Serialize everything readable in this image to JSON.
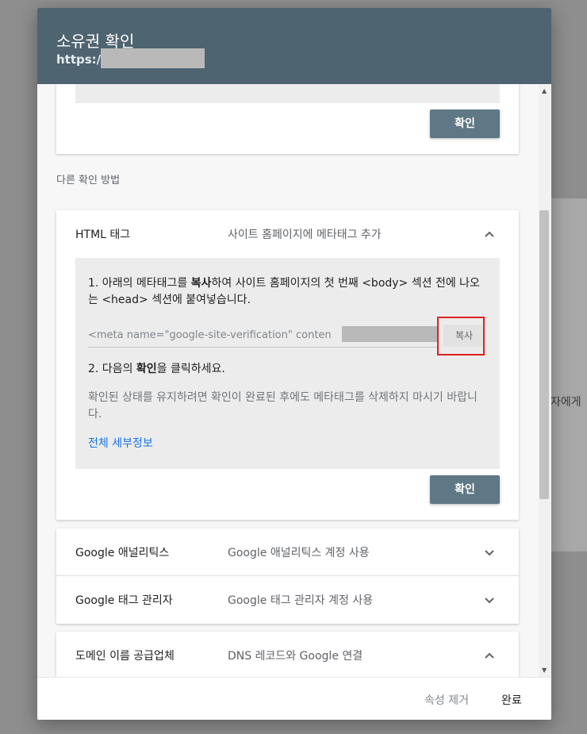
{
  "background": {
    "partial_text": "자에게"
  },
  "dialog": {
    "title": "소유권 확인",
    "url_prefix": "https://"
  },
  "top_card": {
    "confirm_label": "확인"
  },
  "other_methods_label": "다른 확인 방법",
  "html_tag": {
    "title": "HTML 태그",
    "description": "사이트 홈페이지에 메타태그 추가",
    "expanded": true,
    "step1_prefix": "1. 아래의 메타태그를 ",
    "step1_bold": "복사",
    "step1_suffix": "하여 사이트 홈페이지의 첫 번째 <body> 섹션 전에 나오는 <head> 섹션에 붙여넣습니다.",
    "meta_value": "<meta name=\"google-site-verification\" conten",
    "copy_label": "복사",
    "step2_prefix": "2. 다음의 ",
    "step2_bold": "확인",
    "step2_suffix": "을 클릭하세요.",
    "note": "확인된 상태를 유지하려면 확인이 완료된 후에도 메타태그를 삭제하지 마시기 바랍니다.",
    "details_link": "전체 세부정보",
    "confirm_label": "확인"
  },
  "methods": [
    {
      "title": "Google 애널리틱스",
      "description": "Google 애널리틱스 계정 사용",
      "expanded": false
    },
    {
      "title": "Google 태그 관리자",
      "description": "Google 태그 관리자 계정 사용",
      "expanded": false
    },
    {
      "title": "도메인 이름 공급업체",
      "description": "DNS 레코드와 Google 연결",
      "expanded": true
    }
  ],
  "footer": {
    "remove_property_label": "속성 제거",
    "done_label": "완료"
  },
  "colors": {
    "header": "#4f6471",
    "confirm_button": "#5f7886",
    "link": "#1a73e8",
    "highlight_box": "#e02020"
  }
}
